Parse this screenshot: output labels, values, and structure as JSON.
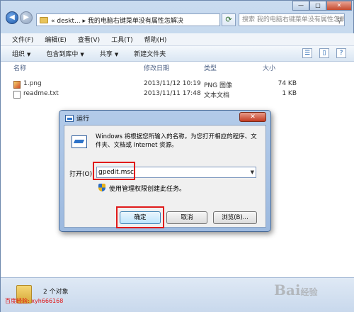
{
  "address": {
    "back": "◀",
    "forward": "▶",
    "path": "« deskt... ▸ 我的电脑右键菜单没有属性怎解决",
    "refresh": "⟳",
    "search_placeholder": "搜索 我的电脑右键菜单没有属性怎解决"
  },
  "window_controls": {
    "minimize": "—",
    "maximize": "□",
    "close": "✕"
  },
  "menu": [
    "文件(F)",
    "编辑(E)",
    "查看(V)",
    "工具(T)",
    "帮助(H)"
  ],
  "commands": [
    "组织",
    "包含到库中",
    "共享",
    "新建文件夹"
  ],
  "columns": {
    "name": "名称",
    "date": "修改日期",
    "type": "类型",
    "size": "大小"
  },
  "files": [
    {
      "name": "1.png",
      "date": "2013/11/12 10:19",
      "type": "PNG 图像",
      "size": "74 KB",
      "icon": "png-file-icon"
    },
    {
      "name": "readme.txt",
      "date": "2013/11/11 17:48",
      "type": "文本文档",
      "size": "1 KB",
      "icon": "text-file-icon"
    }
  ],
  "status": {
    "count": "2 个对象"
  },
  "watermark": {
    "text": "百度经验: xyh666168",
    "logo_main": "Bai",
    "logo_sub": "经验"
  },
  "dialog": {
    "title": "运行",
    "close": "✕",
    "description": "Windows 将根据您所输入的名称，为您打开相应的程序、文件夹、文档或 Internet 资源。",
    "open_label": "打开(O):",
    "open_value": "gpedit.msc",
    "admin_note": "使用管理权限创建此任务。",
    "ok": "确定",
    "cancel": "取消",
    "browse": "浏览(B)..."
  },
  "colors": {
    "highlight": "#e01a1a",
    "accent": "#3c7fb1"
  }
}
